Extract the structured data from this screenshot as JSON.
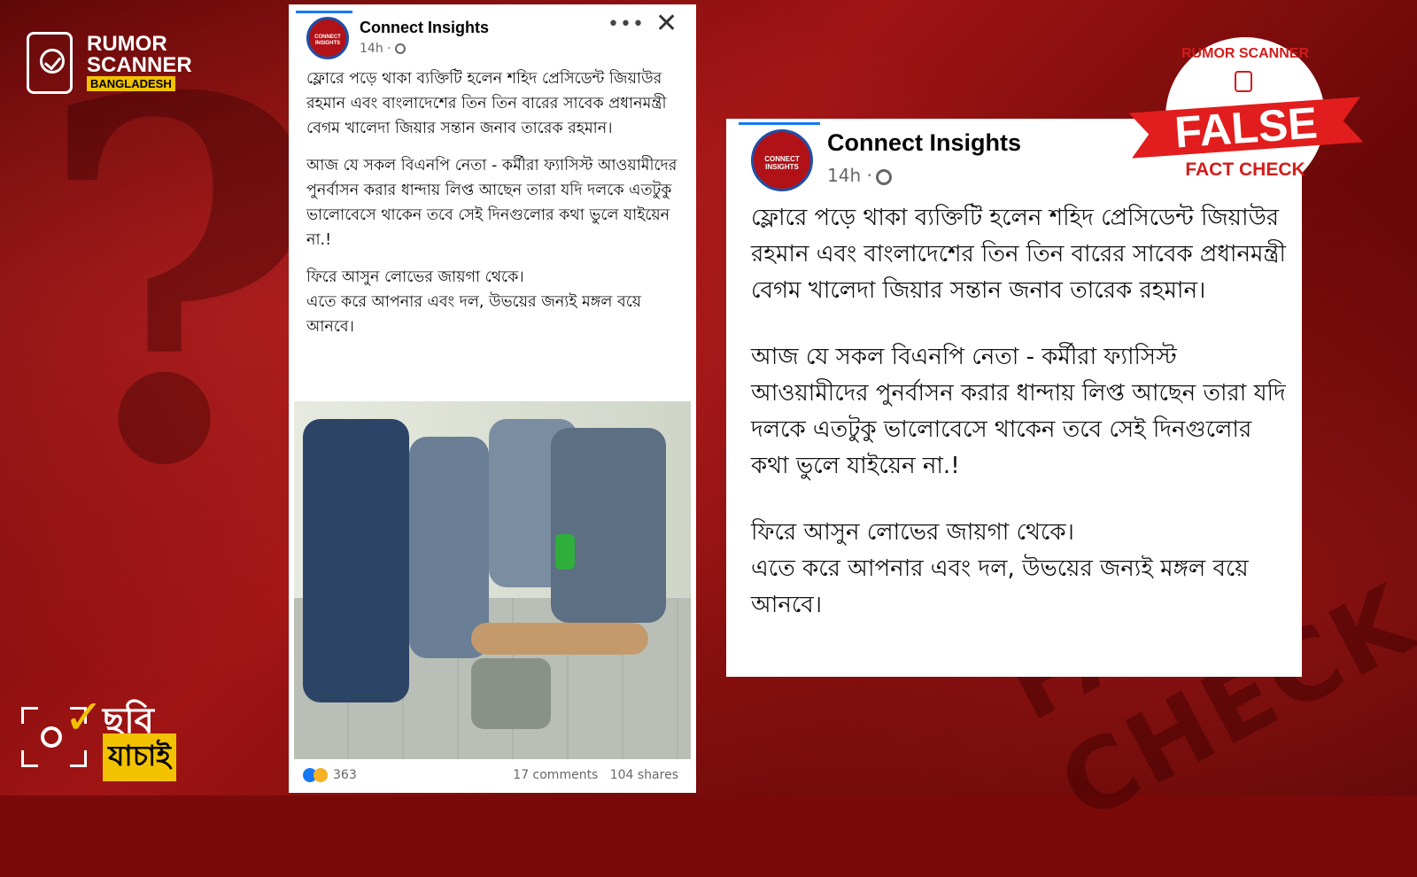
{
  "brand": {
    "line1": "RUMOR",
    "line2": "SCANNER",
    "line3": "BANGLADESH"
  },
  "chobi": {
    "line1": "ছবি",
    "line2": "যাচাই"
  },
  "background_stamp": "FACT CHECK",
  "badge": {
    "top": "RUMOR SCANNER",
    "verdict": "FALSE",
    "bottom": "FACT CHECK"
  },
  "post": {
    "page_name": "Connect Insights",
    "avatar_text": "CONNECT INSIGHTS",
    "time": "14h ·",
    "more_icon": "•••",
    "close_icon": "✕",
    "paragraph1": "ফ্লোরে পড়ে থাকা ব্যক্তিটি হলেন শহিদ প্রেসিডেন্ট জিয়াউর রহমান এবং বাংলাদেশের তিন তিন বারের সাবেক প্রধানমন্ত্রী বেগম খালেদা জিয়ার সন্তান জনাব তারেক রহমান।",
    "paragraph2": "আজ যে সকল বিএনপি নেতা - কর্মীরা  ফ্যাসিস্ট আওয়ামীদের পুনর্বাসন করার ধান্দায় লিপ্ত আছেন তারা যদি দলকে এতটুকু ভালোবেসে থাকেন তবে সেই দিনগুলোর কথা ভুলে যাইয়েন না.!",
    "paragraph3_line1": "ফিরে আসুন লোভের জায়গা থেকে।",
    "paragraph3_line2": "এতে করে আপনার এবং দল, উভয়ের জন্যই মঙ্গল বয়ে আনবে।",
    "reactions_count": "363",
    "comments": "17 comments",
    "shares": "104 shares"
  },
  "colors": {
    "facebook_blue": "#1877f2",
    "badge_red": "#e21d1d",
    "accent_yellow": "#f2c200"
  }
}
